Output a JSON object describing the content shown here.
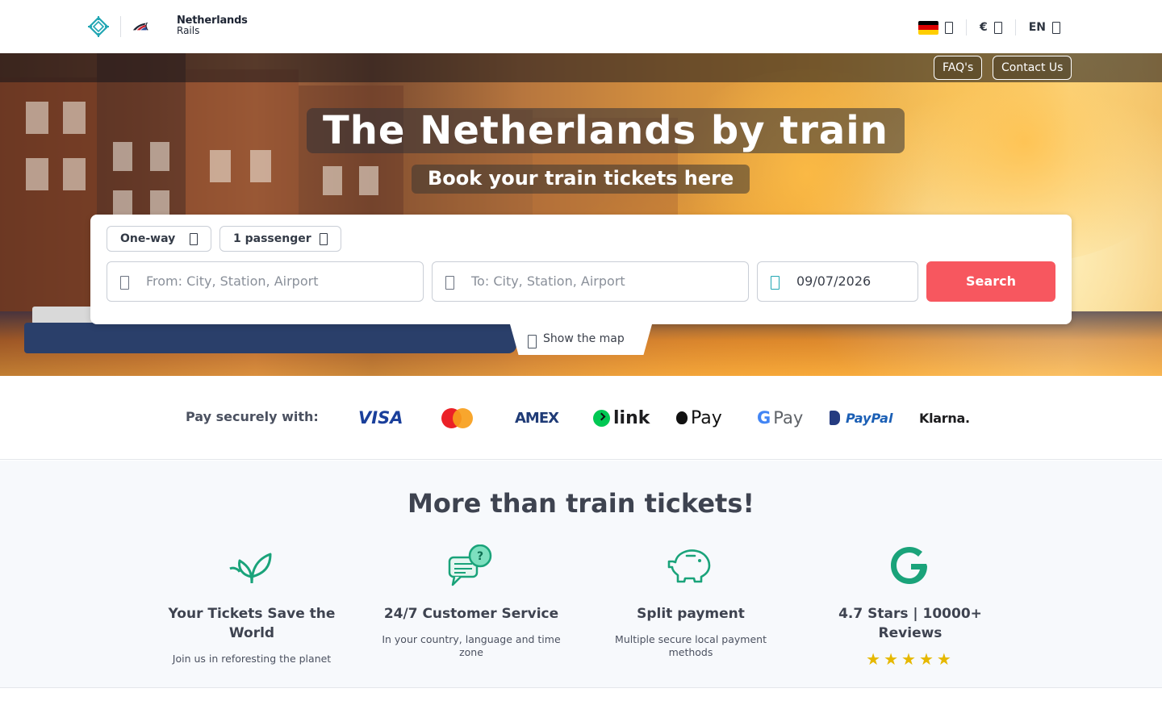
{
  "header": {
    "brand_line1": "Netherlands",
    "brand_line2": "Rails",
    "flag_colors": [
      "#000000",
      "#dd0000",
      "#ffce00"
    ],
    "currency": "€",
    "language": "EN"
  },
  "hero": {
    "nav": {
      "faq_label": "FAQ's",
      "contact_label": "Contact Us"
    },
    "title": "The Netherlands by train",
    "subtitle": "Book your train tickets here"
  },
  "search": {
    "trip_type": "One-way",
    "passengers": "1 passenger",
    "from_placeholder": "From: City, Station, Airport",
    "to_placeholder": "To: City, Station, Airport",
    "date_value": "09/07/2026",
    "search_label": "Search",
    "map_label": "Show the map",
    "accent_color": "#f7575f"
  },
  "payments": {
    "label": "Pay securely with:",
    "methods": [
      "VISA",
      "Mastercard",
      "AMEX",
      "link",
      "Pay",
      "Pay",
      "PayPal",
      "Klarna."
    ]
  },
  "features": {
    "title": "More than train tickets!",
    "items": [
      {
        "icon": "leaf-icon",
        "heading": "Your Tickets Save the World",
        "text": "Join us in reforesting the planet"
      },
      {
        "icon": "chat-question-icon",
        "heading": "24/7 Customer Service",
        "text": "In your country, language and time zone"
      },
      {
        "icon": "piggy-bank-icon",
        "heading": "Split payment",
        "text": "Multiple secure local payment methods"
      },
      {
        "icon": "google-icon",
        "heading": "4.7 Stars | 10000+ Reviews",
        "text": "",
        "stars": 5
      }
    ],
    "icon_color": "#1aa37a",
    "star_color": "#e6b800"
  }
}
